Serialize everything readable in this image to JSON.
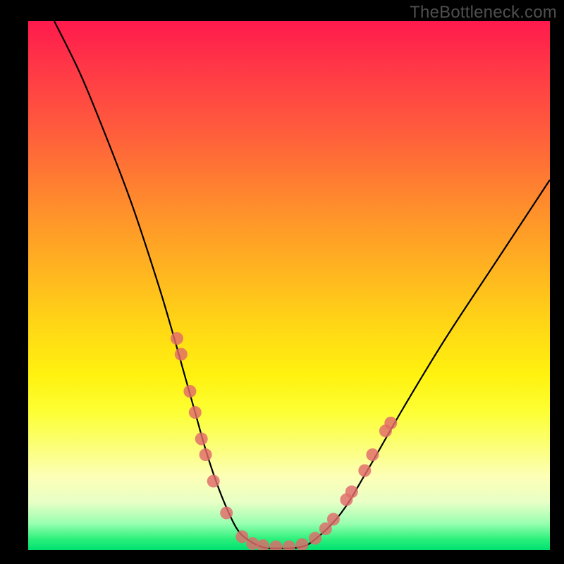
{
  "watermark": "TheBottleneck.com",
  "chart_data": {
    "type": "line",
    "title": "",
    "xlabel": "",
    "ylabel": "",
    "xlim": [
      0,
      100
    ],
    "ylim": [
      0,
      100
    ],
    "grid": false,
    "series": [
      {
        "name": "bottleneck-curve",
        "color": "#000000",
        "x": [
          5,
          10,
          15,
          20,
          25,
          28,
          30,
          32,
          34,
          36,
          38,
          40,
          42,
          45,
          48,
          52,
          55,
          60,
          65,
          72,
          80,
          90,
          100
        ],
        "y": [
          100,
          90,
          78,
          65,
          50,
          40,
          33,
          26,
          19,
          13,
          8,
          4,
          2,
          0.5,
          0.3,
          0.5,
          2,
          7,
          15,
          27,
          40,
          55,
          70
        ]
      }
    ],
    "markers": {
      "name": "highlight-points",
      "color": "#e06a6a",
      "radius_px": 9,
      "points": [
        {
          "x": 28.5,
          "y": 40
        },
        {
          "x": 29.3,
          "y": 37
        },
        {
          "x": 31.0,
          "y": 30
        },
        {
          "x": 32.0,
          "y": 26
        },
        {
          "x": 33.2,
          "y": 21
        },
        {
          "x": 34.0,
          "y": 18
        },
        {
          "x": 35.5,
          "y": 13
        },
        {
          "x": 38.0,
          "y": 7
        },
        {
          "x": 41.0,
          "y": 2.5
        },
        {
          "x": 43.0,
          "y": 1.2
        },
        {
          "x": 45.0,
          "y": 0.8
        },
        {
          "x": 47.5,
          "y": 0.6
        },
        {
          "x": 50.0,
          "y": 0.6
        },
        {
          "x": 52.5,
          "y": 1.0
        },
        {
          "x": 55.0,
          "y": 2.2
        },
        {
          "x": 57.0,
          "y": 4.0
        },
        {
          "x": 58.5,
          "y": 5.8
        },
        {
          "x": 61.0,
          "y": 9.5
        },
        {
          "x": 62.0,
          "y": 11
        },
        {
          "x": 64.5,
          "y": 15
        },
        {
          "x": 66.0,
          "y": 18
        },
        {
          "x": 68.5,
          "y": 22.5
        },
        {
          "x": 69.5,
          "y": 24
        }
      ]
    }
  }
}
